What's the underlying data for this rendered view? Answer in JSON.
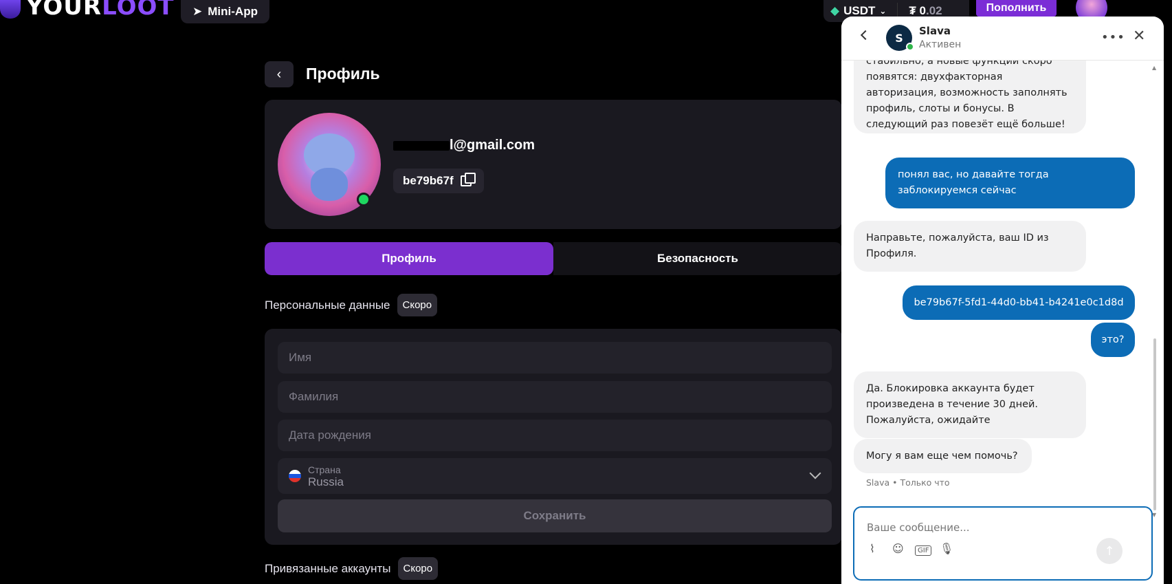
{
  "topbar": {
    "logo_your": "YOUR",
    "logo_loot": "LOOT",
    "miniapp_label": "Mini-App",
    "currency": "USDT",
    "balance_prefix": "₮ 0",
    "balance_suffix": ".02",
    "topup_label": "Пополнить"
  },
  "profile": {
    "title": "Профиль",
    "email_visible": "l@gmail.com",
    "user_id_short": "be79b67f",
    "tabs": [
      {
        "label": "Профиль",
        "active": true
      },
      {
        "label": "Безопасность",
        "active": false
      }
    ],
    "personal_section": "Персональные данные",
    "soon_badge": "Скоро",
    "fields": {
      "first_name_placeholder": "Имя",
      "last_name_placeholder": "Фамилия",
      "birthdate_placeholder": "Дата рождения",
      "country_label": "Страна",
      "country_value": "Russia"
    },
    "save_label": "Сохранить",
    "linked_section": "Привязанные аккаунты"
  },
  "chat": {
    "agent_initial": "S",
    "agent_name": "Slava",
    "agent_status": "Активен",
    "messages": [
      {
        "dir": "in",
        "text": "стабильно, а новые функции скоро появятся: двухфакторная авторизация, возможность заполнять профиль, слоты и бонусы. В следующий раз повезёт ещё больше!"
      },
      {
        "dir": "out",
        "text": "понял вас, но давайте тогда заблокируемся сейчас"
      },
      {
        "dir": "in",
        "text": "Направьте, пожалуйста, ваш ID из Профиля."
      },
      {
        "dir": "out",
        "text": "be79b67f-5fd1-44d0-bb41-b4241e0c1d8d"
      },
      {
        "dir": "out",
        "text": "это?"
      },
      {
        "dir": "in",
        "text": "Да. Блокировка аккаунта будет произведена в течение 30 дней. Пожалуйста, ожидайте"
      },
      {
        "dir": "in",
        "text": "Могу я вам еще чем помочь?"
      }
    ],
    "meta": "Slava • Только что",
    "input_placeholder": "Ваше сообщение..."
  }
}
